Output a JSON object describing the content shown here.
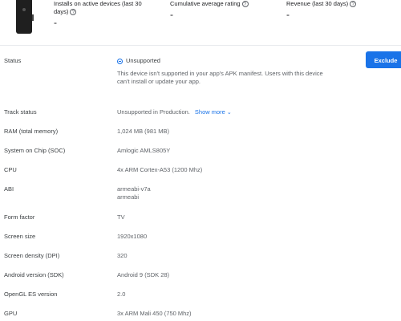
{
  "stats": [
    {
      "label": "Installs on active devices (last 30 days)",
      "value": "-"
    },
    {
      "label": "Cumulative average rating",
      "value": "-"
    },
    {
      "label": "Revenue (last 30 days)",
      "value": "-"
    }
  ],
  "status": {
    "label": "Status",
    "value": "Unsupported",
    "description": "This device isn't supported in your app's APK manifest. Users with this device can't install or update your app.",
    "icon": "unsupported-icon",
    "accent": "#1a73e8"
  },
  "actions": {
    "exclude_label": "Exclude"
  },
  "track_status": {
    "label": "Track status",
    "value": "Unsupported in Production.",
    "link": "Show more"
  },
  "specs": [
    {
      "label": "RAM (total memory)",
      "value": "1,024 MB (981 MB)"
    },
    {
      "label": "System on Chip (SOC)",
      "value": "Amlogic AMLS805Y"
    },
    {
      "label": "CPU",
      "value": "4x ARM Cortex-A53 (1200 Mhz)"
    },
    {
      "label": "ABI",
      "value": "armeabi-v7a",
      "value2": "armeabi"
    },
    {
      "label": "Form factor",
      "value": "TV"
    },
    {
      "label": "Screen size",
      "value": "1920x1080"
    },
    {
      "label": "Screen density (DPI)",
      "value": "320"
    },
    {
      "label": "Android version (SDK)",
      "value": "Android 9 (SDK 28)"
    },
    {
      "label": "OpenGL ES version",
      "value": "2.0"
    },
    {
      "label": "GPU",
      "value": "3x ARM Mali 450 (750 Mhz)"
    }
  ]
}
